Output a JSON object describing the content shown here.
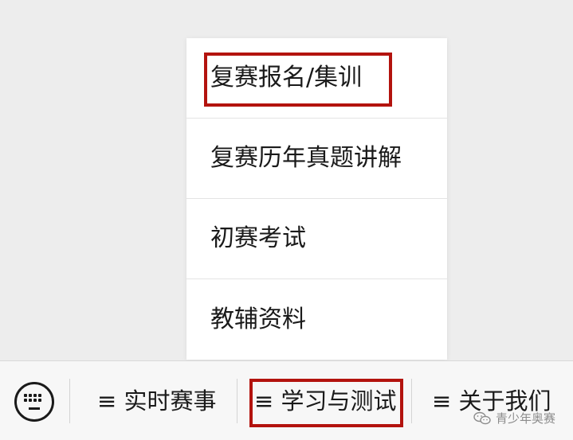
{
  "popup_menu": {
    "items": [
      {
        "label": "复赛报名/集训"
      },
      {
        "label": "复赛历年真题讲解"
      },
      {
        "label": "初赛考试"
      },
      {
        "label": "教辅资料"
      }
    ]
  },
  "bottom_bar": {
    "keyboard_icon": "keyboard-icon",
    "tabs": [
      {
        "label": "≡ 实时赛事"
      },
      {
        "label": "≡ 学习与测试"
      },
      {
        "label": "≡ 关于我们"
      }
    ]
  },
  "watermark": {
    "text": "青少年奥赛",
    "icon": "wechat-icon"
  },
  "colors": {
    "highlight": "#b3130e",
    "background": "#ededed",
    "menu_bg": "#ffffff"
  }
}
